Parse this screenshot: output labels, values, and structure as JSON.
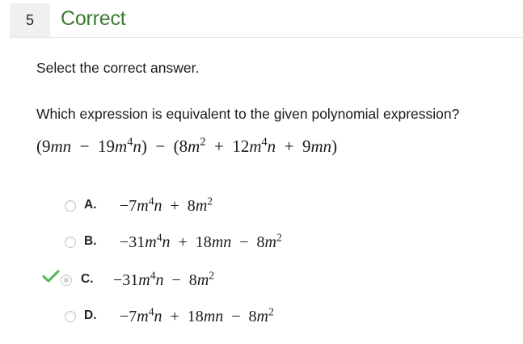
{
  "header": {
    "question_number": "5",
    "status": "Correct"
  },
  "instruction": "Select the correct answer.",
  "question": "Which expression is equivalent to the given polynomial expression?",
  "expression": "(9mn − 19m⁴n) − (8m² + 12m⁴n + 9mn)",
  "options": [
    {
      "letter": "A.",
      "expression": "−7m⁴n + 8m²",
      "selected": false
    },
    {
      "letter": "B.",
      "expression": "−31m⁴n + 18mn − 8m²",
      "selected": false
    },
    {
      "letter": "C.",
      "expression": "−31m⁴n − 8m²",
      "selected": true,
      "marked_correct": true
    },
    {
      "letter": "D.",
      "expression": "−7m⁴n + 18mn − 8m²",
      "selected": false
    }
  ],
  "colors": {
    "status_green": "#3d7a34",
    "check_green": "#5cb85c"
  },
  "icons": {
    "correct_mark": "checkmark-icon",
    "choice": "radio-icon"
  }
}
